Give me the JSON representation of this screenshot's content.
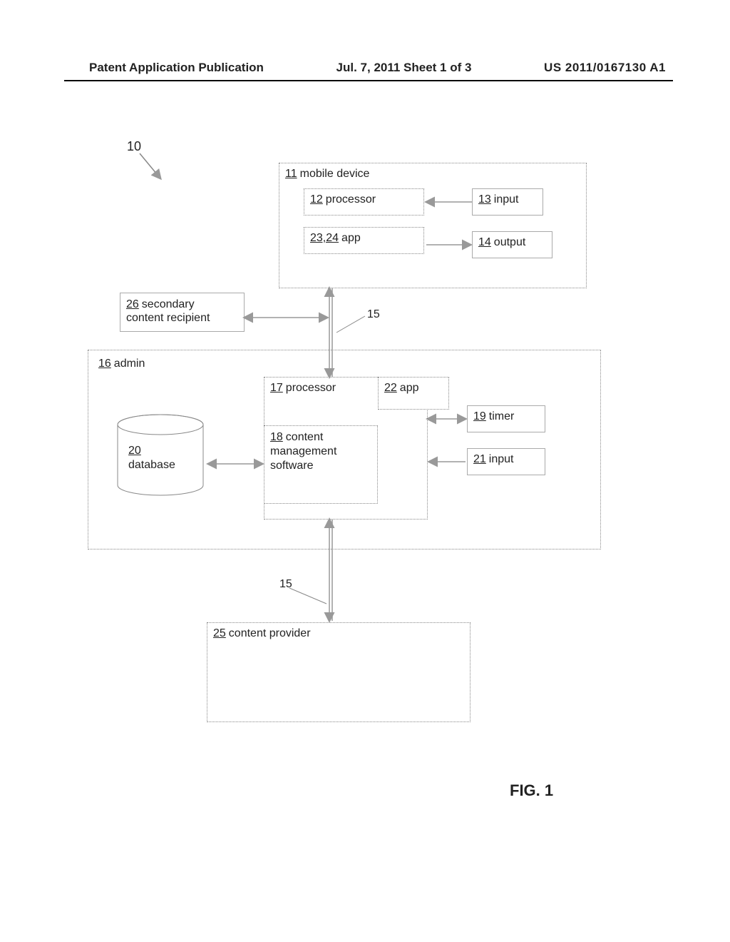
{
  "header": {
    "left": "Patent Application Publication",
    "mid": "Jul. 7, 2011   Sheet 1 of 3",
    "right": "US 2011/0167130 A1"
  },
  "labels": {
    "system_ref": "10",
    "mobile_device": {
      "ref": "11",
      "text": "mobile device"
    },
    "processor_top": {
      "ref": "12",
      "text": "processor"
    },
    "input_top": {
      "ref": "13",
      "text": "input"
    },
    "app_top": {
      "ref": "23,24",
      "text": "app"
    },
    "output_top": {
      "ref": "14",
      "text": "output"
    },
    "secondary": {
      "ref": "26",
      "text_line1": "secondary",
      "text_line2": "content recipient"
    },
    "conn15_top": "15",
    "admin": {
      "ref": "16",
      "text": "admin"
    },
    "processor_mid": {
      "ref": "17",
      "text": "processor"
    },
    "app_mid": {
      "ref": "22",
      "text": "app"
    },
    "timer": {
      "ref": "19",
      "text": "timer"
    },
    "cms": {
      "ref": "18",
      "text_line1": "content",
      "text_line2": "management",
      "text_line3": "software"
    },
    "input_mid": {
      "ref": "21",
      "text": "input"
    },
    "database": {
      "ref": "20",
      "text": "database"
    },
    "conn15_bottom": "15",
    "content_provider": {
      "ref": "25",
      "text": "content provider"
    }
  },
  "figure": "FIG. 1"
}
